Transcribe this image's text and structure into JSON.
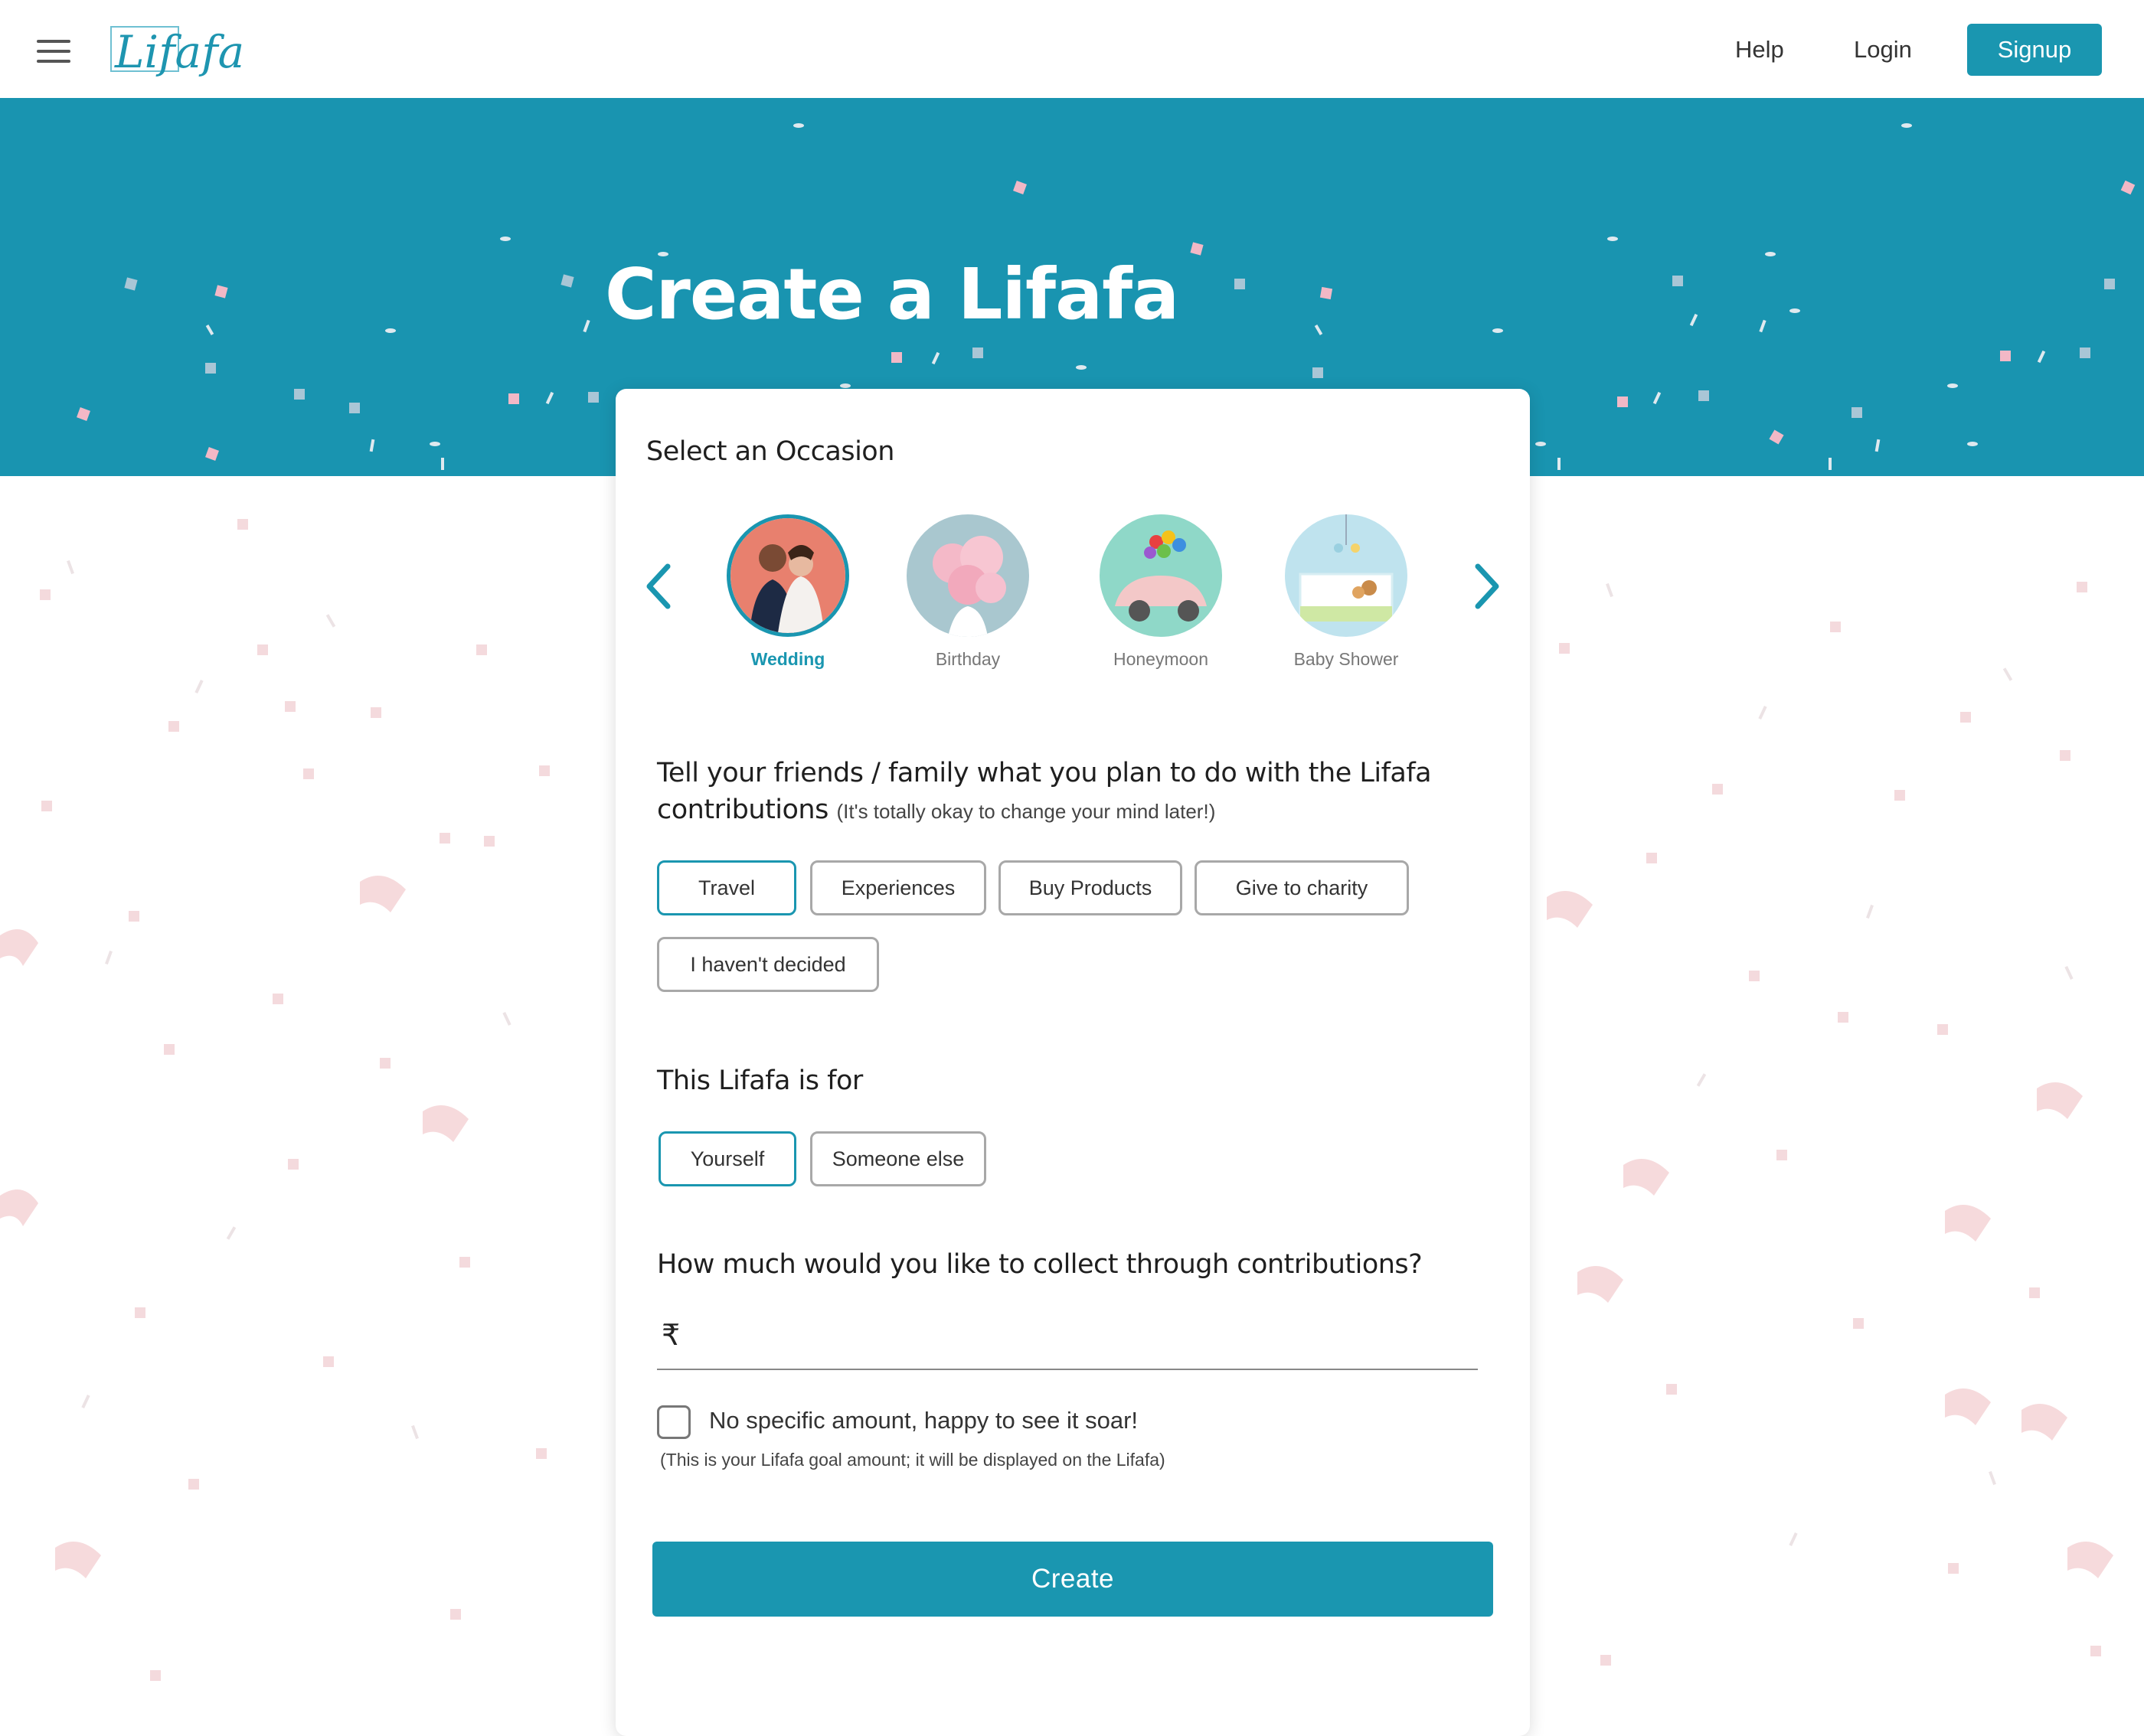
{
  "header": {
    "logo_text": "Lifafa",
    "nav": {
      "help": "Help",
      "login": "Login",
      "signup": "Signup"
    }
  },
  "hero": {
    "title": "Create a Lifafa"
  },
  "form": {
    "occasion_title": "Select an Occasion",
    "occasions": [
      {
        "label": "Wedding",
        "selected": true
      },
      {
        "label": "Birthday",
        "selected": false
      },
      {
        "label": "Honeymoon",
        "selected": false
      },
      {
        "label": "Baby Shower",
        "selected": false
      }
    ],
    "plan_question": "Tell your friends / family what you plan to do with the Lifafa contributions",
    "plan_hint": "(It's totally okay to change your mind later!)",
    "plan_options": [
      "Travel",
      "Experiences",
      "Buy Products",
      "Give to charity",
      "I haven't decided"
    ],
    "plan_selected": "Travel",
    "for_question": "This Lifafa is for",
    "for_options": [
      "Yourself",
      "Someone else"
    ],
    "for_selected": "Yourself",
    "amount_question": "How much would you like to collect through contributions?",
    "currency_symbol": "₹",
    "amount_value": "",
    "no_amount_label": "No specific amount, happy to see it soar!",
    "no_amount_checked": false,
    "goal_note": "(This is your Lifafa goal amount; it will be displayed on the Lifafa)",
    "create_label": "Create"
  },
  "colors": {
    "accent": "#1a96b0",
    "hero_bg": "#1994b0",
    "confetti_pink": "#f3d3d5"
  },
  "icons": [
    "menu-icon",
    "chevron-left-icon",
    "chevron-right-icon",
    "rupee-icon"
  ]
}
